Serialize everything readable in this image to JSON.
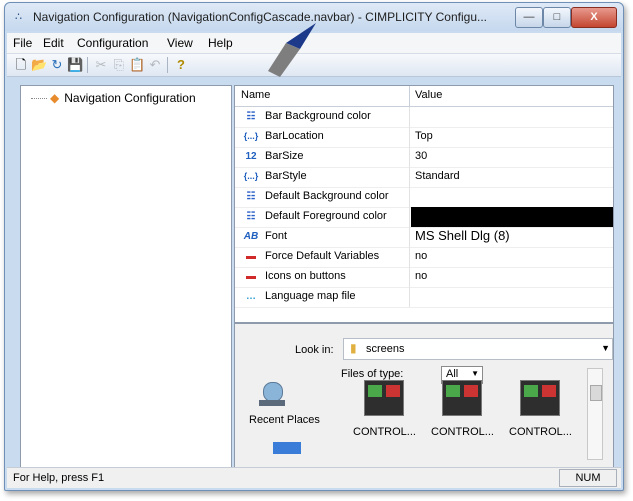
{
  "window": {
    "title": "Navigation Configuration (NavigationConfigCascade.navbar) - CIMPLICITY Configu...",
    "minimize": "—",
    "maximize": "□",
    "close": "X"
  },
  "menu": [
    "File",
    "Edit",
    "Configuration",
    "View",
    "Help"
  ],
  "toolbar": {
    "new": "🗋",
    "open": "📂",
    "refresh": "↻",
    "save": "💾",
    "cut": "✂",
    "copy": "⎘",
    "paste": "📋",
    "undo": "↶",
    "help": "?"
  },
  "tree": {
    "root_label": "Navigation Configuration",
    "icon": "diamond-icon"
  },
  "grid": {
    "name_header": "Name",
    "value_header": "Value",
    "rows": [
      {
        "icon": "color-grid-icon",
        "glyph": "☷",
        "name": "Bar Background color",
        "value": ""
      },
      {
        "icon": "enum-icon",
        "glyph": "{...}",
        "name": "BarLocation",
        "value": "Top"
      },
      {
        "icon": "number-icon",
        "glyph": "12",
        "name": "BarSize",
        "value": "30"
      },
      {
        "icon": "enum-icon",
        "glyph": "{...}",
        "name": "BarStyle",
        "value": "Standard"
      },
      {
        "icon": "color-grid-icon",
        "glyph": "☷",
        "name": "Default Background color",
        "value": ""
      },
      {
        "icon": "color-grid-icon",
        "glyph": "☷",
        "name": "Default Foreground color",
        "value": ""
      },
      {
        "icon": "font-icon",
        "glyph": "AB",
        "name": "Font",
        "value": "MS Shell Dlg (8)"
      },
      {
        "icon": "boolean-icon",
        "glyph": "▬",
        "name": "Force Default Variables",
        "value": "no"
      },
      {
        "icon": "boolean-icon",
        "glyph": "▬",
        "name": "Icons on buttons",
        "value": "no"
      },
      {
        "icon": "file-icon",
        "glyph": "…",
        "name": "Language map file",
        "value": ""
      }
    ]
  },
  "file_browser": {
    "look_in_label": "Look in:",
    "look_in_value": "screens",
    "files_of_type_label": "Files of type:",
    "files_of_type_value": "All",
    "recent_places": "Recent Places",
    "items": [
      "CONTROL...",
      "CONTROL...",
      "CONTROL..."
    ]
  },
  "status": {
    "help_text": "For Help, press F1",
    "num": "NUM"
  },
  "colors": {
    "foreground_swatch": "#000000",
    "title_bar": "#c9dbee",
    "close_button": "#c34631"
  }
}
